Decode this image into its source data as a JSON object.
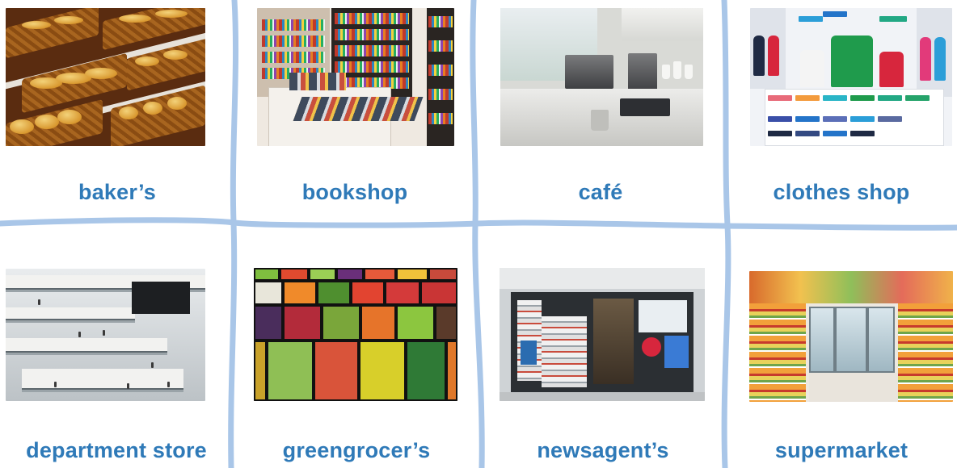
{
  "board": {
    "divider_color": "#a9c6e8",
    "label_color": "#2f7ab8",
    "cards": [
      {
        "label": "baker’s",
        "photo_icon": "bakery-photo"
      },
      {
        "label": "bookshop",
        "photo_icon": "bookshop-photo"
      },
      {
        "label": "café",
        "photo_icon": "cafe-photo"
      },
      {
        "label": "clothes shop",
        "photo_icon": "clothes-shop-photo"
      },
      {
        "label": "department store",
        "photo_icon": "department-store-photo"
      },
      {
        "label": "greengrocer’s",
        "photo_icon": "greengrocer-photo"
      },
      {
        "label": "newsagent’s",
        "photo_icon": "newsagent-photo"
      },
      {
        "label": "supermarket",
        "photo_icon": "supermarket-photo"
      }
    ]
  }
}
